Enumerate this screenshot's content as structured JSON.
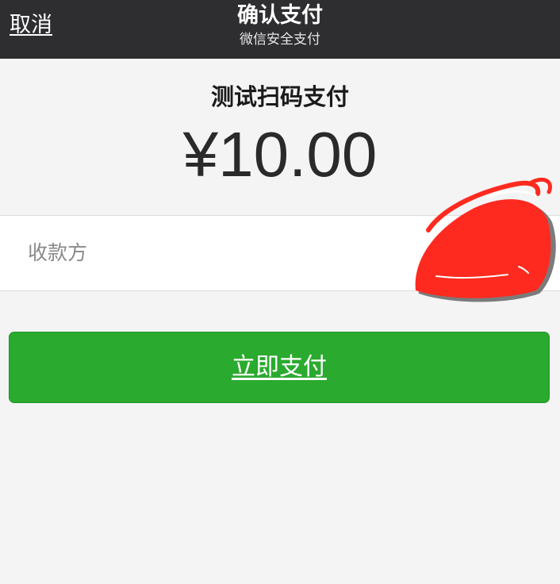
{
  "navbar": {
    "cancel_label": "取消",
    "title": "确认支付",
    "subtitle": "微信安全支付"
  },
  "order": {
    "name": "测试扫码支付",
    "amount": "¥10.00"
  },
  "payee": {
    "label": "收款方"
  },
  "actions": {
    "pay_label": "立即支付"
  },
  "colors": {
    "navbar_bg": "#2e2e31",
    "page_bg": "#f4f4f4",
    "pay_button": "#2aaa2e",
    "redaction": "#ff2a1f"
  }
}
